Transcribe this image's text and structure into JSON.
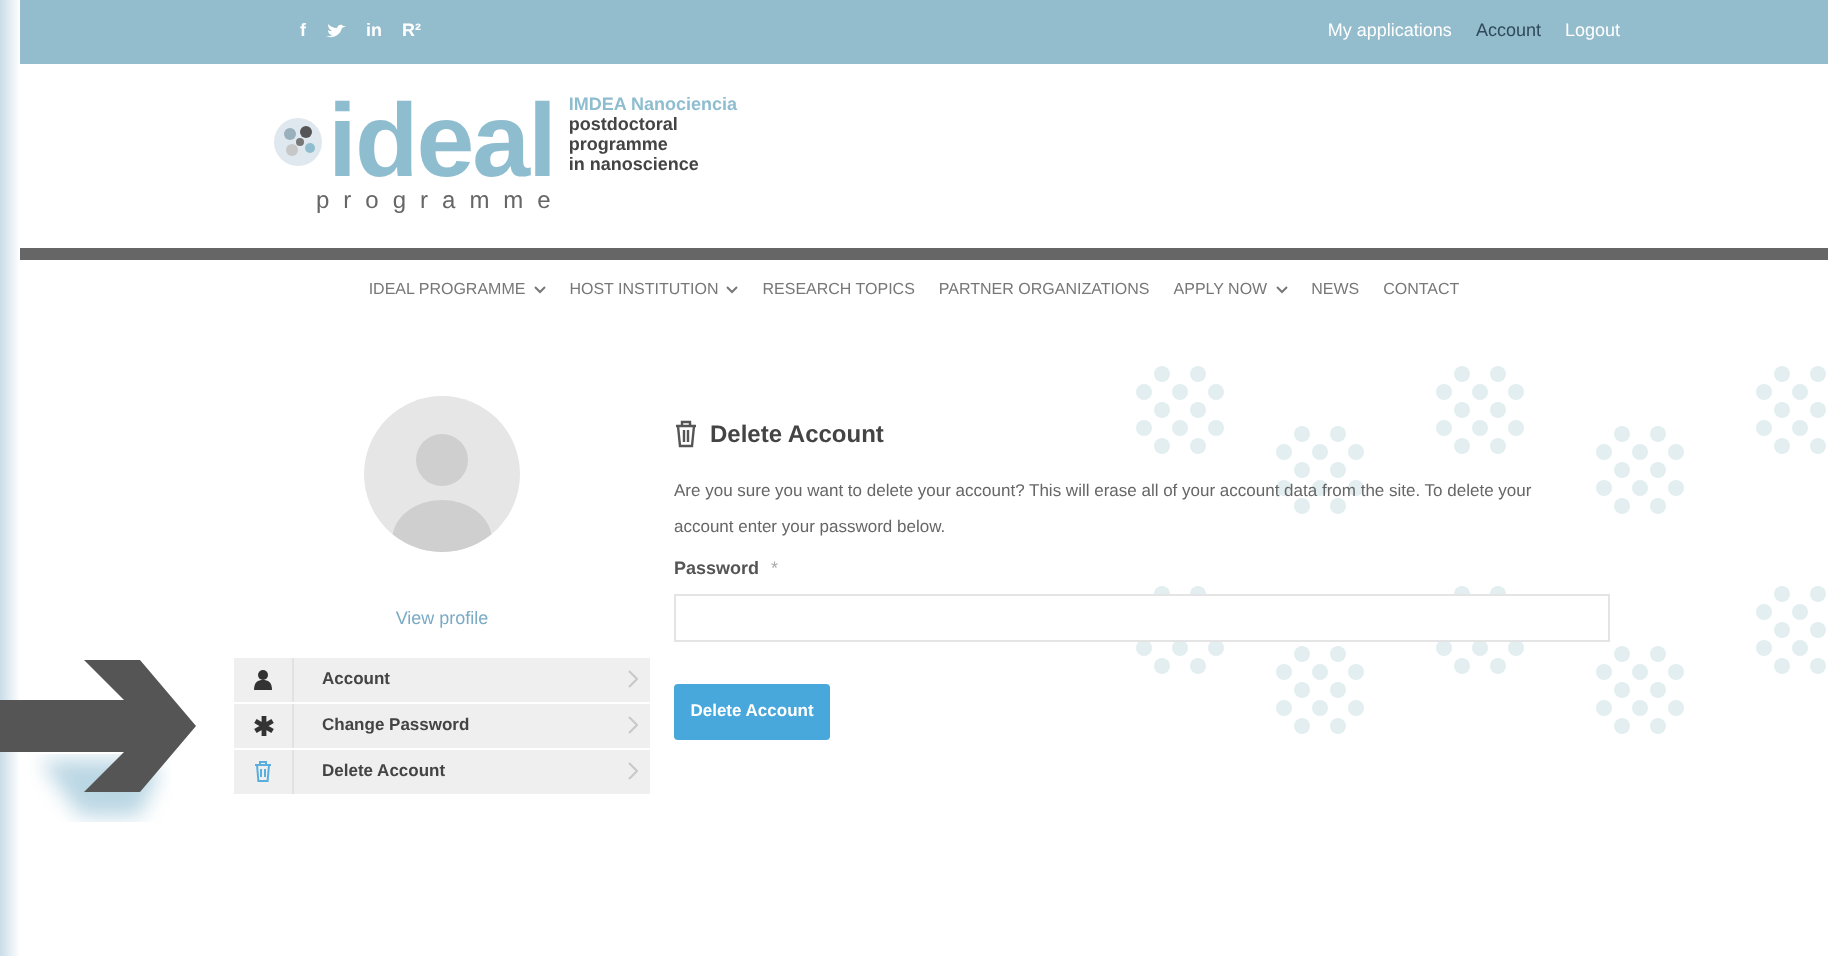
{
  "top_bar": {
    "social": [
      {
        "kind": "glyph",
        "text": "f"
      },
      {
        "kind": "bird"
      },
      {
        "kind": "glyph",
        "text": "in"
      },
      {
        "kind": "glyph",
        "text": "R²"
      }
    ],
    "links": [
      {
        "label": "My applications",
        "selected": false
      },
      {
        "label": "Account",
        "selected": true
      },
      {
        "label": "Logout",
        "selected": false
      }
    ]
  },
  "logo": {
    "word": "ideal",
    "sub": "programme",
    "org": "IMDEA Nanociencia",
    "tagline": [
      "postdoctoral",
      "programme",
      "in nanoscience"
    ]
  },
  "nav": [
    {
      "label": "IDEAL PROGRAMME",
      "dropdown": true
    },
    {
      "label": "HOST INSTITUTION",
      "dropdown": true
    },
    {
      "label": "RESEARCH TOPICS",
      "dropdown": false
    },
    {
      "label": "PARTNER ORGANIZATIONS",
      "dropdown": false
    },
    {
      "label": "APPLY NOW",
      "dropdown": true
    },
    {
      "label": "NEWS",
      "dropdown": false
    },
    {
      "label": "CONTACT",
      "dropdown": false
    }
  ],
  "sidebar": {
    "view_profile": "View profile",
    "menu": [
      {
        "kind": "person",
        "label": "Account",
        "selected": false
      },
      {
        "kind": "asterisk",
        "label": "Change Password",
        "selected": false
      },
      {
        "kind": "trash",
        "label": "Delete Account",
        "selected": true
      }
    ]
  },
  "main": {
    "title": "Delete Account",
    "message": "Are you sure you want to delete your account? This will erase all of your account data from the site. To delete your account enter your password below.",
    "field_label": "Password",
    "required_mark": "*",
    "button": "Delete Account"
  }
}
